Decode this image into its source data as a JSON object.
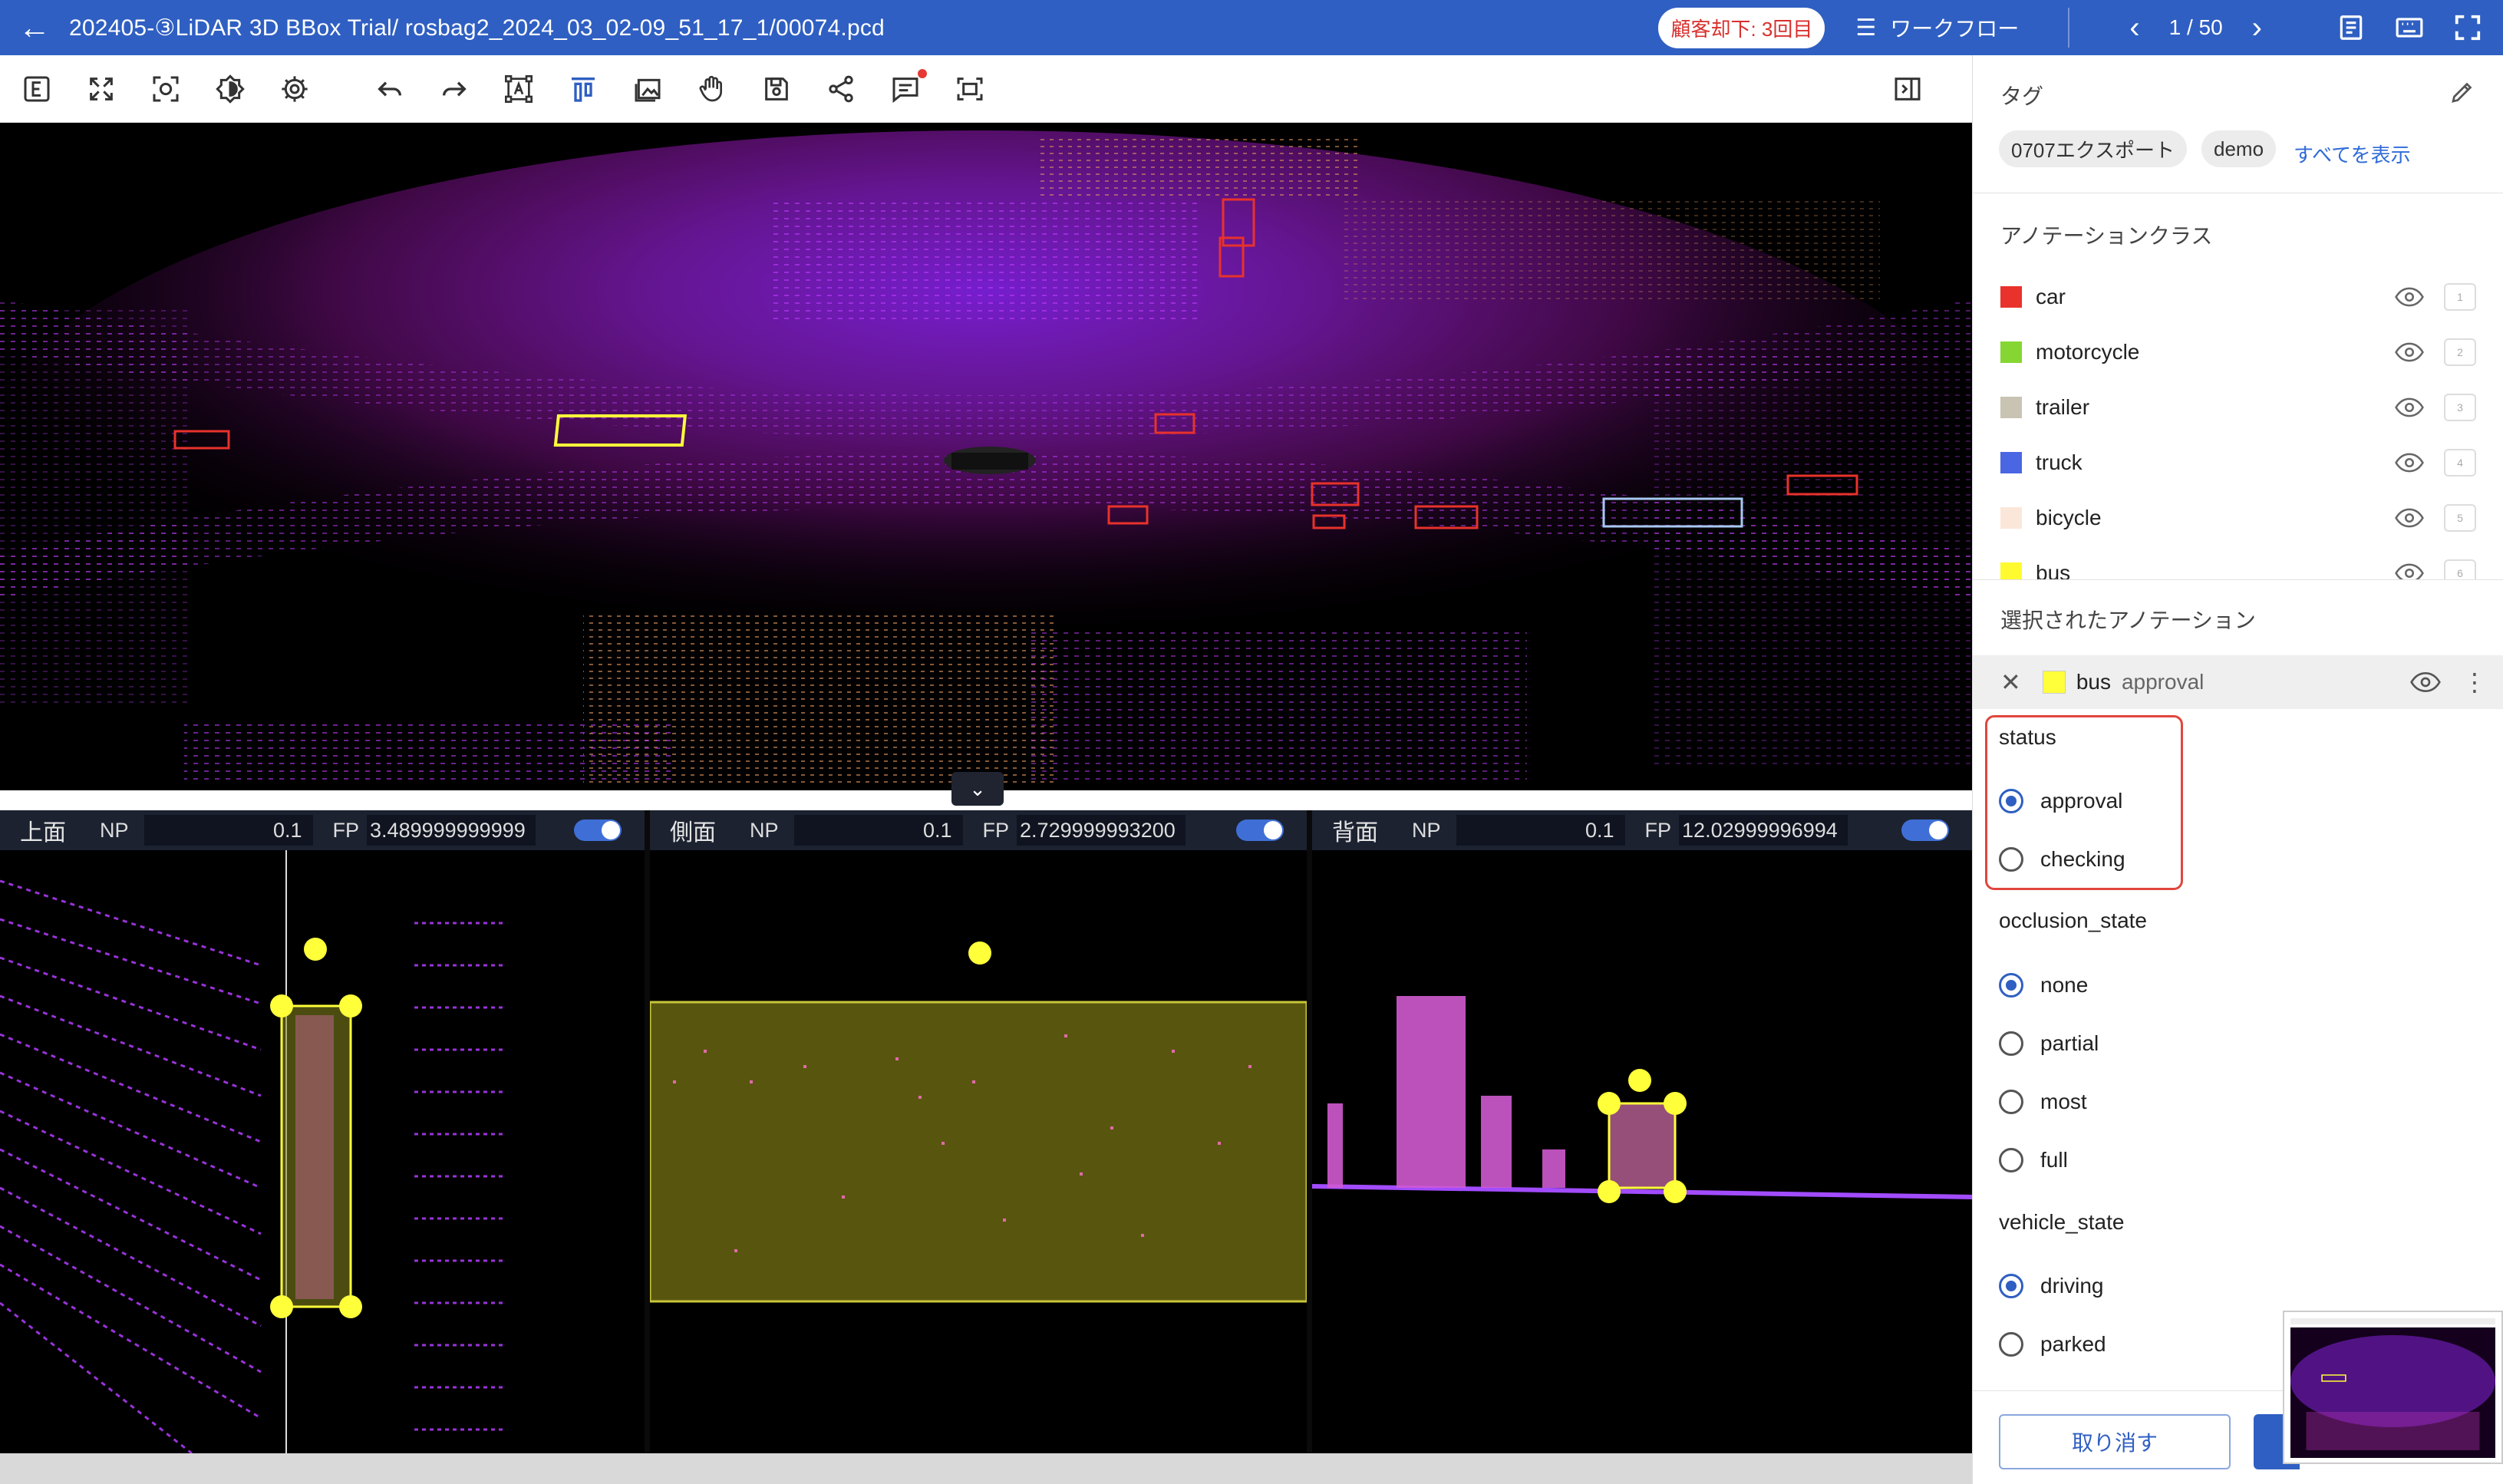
{
  "header": {
    "title": "202405-③LiDAR 3D BBox Trial/ rosbag2_2024_03_02-09_51_17_1/00074.pcd",
    "reject_badge": "顧客却下: 3回目",
    "workflow_label": "ワークフロー",
    "page_indicator": "1 / 50"
  },
  "toolbar": {
    "tools": [
      "e-square-icon",
      "expand-icon",
      "focus-icon",
      "brightness-icon",
      "settings-icon",
      "undo-icon",
      "redo-icon",
      "text-box-icon",
      "align-icon",
      "image-icon",
      "hand-icon",
      "save-icon",
      "share-icon",
      "comment-icon",
      "capture-icon"
    ],
    "active_tool": "align-icon"
  },
  "views": {
    "top": {
      "name": "上面",
      "np_label": "NP",
      "np_value": "0.1",
      "fp_label": "FP",
      "fp_value": "3.489999999999"
    },
    "side": {
      "name": "側面",
      "np_label": "NP",
      "np_value": "0.1",
      "fp_label": "FP",
      "fp_value": "2.729999993200"
    },
    "back": {
      "name": "背面",
      "np_label": "NP",
      "np_value": "0.1",
      "fp_label": "FP",
      "fp_value": "12.02999996994"
    }
  },
  "panel": {
    "tags_title": "タグ",
    "tags": [
      "0707エクスポート",
      "demo"
    ],
    "show_all": "すべてを表示",
    "classes_title": "アノテーションクラス",
    "classes": [
      {
        "name": "car",
        "color": "#e8322b",
        "key": "1"
      },
      {
        "name": "motorcycle",
        "color": "#86d633",
        "key": "2"
      },
      {
        "name": "trailer",
        "color": "#c9c3b3",
        "key": "3"
      },
      {
        "name": "truck",
        "color": "#4a66e3",
        "key": "4"
      },
      {
        "name": "bicycle",
        "color": "#fbe7d9",
        "key": "5"
      },
      {
        "name": "bus",
        "color": "#fffa2f",
        "key": "6"
      }
    ],
    "selected_title": "選択されたアノテーション",
    "selected": {
      "class": "bus",
      "status": "approval"
    },
    "attributes": {
      "status": {
        "label": "status",
        "options": [
          "approval",
          "checking"
        ],
        "selected": "approval"
      },
      "occlusion_state": {
        "label": "occlusion_state",
        "options": [
          "none",
          "partial",
          "most",
          "full"
        ],
        "selected": "none"
      },
      "vehicle_state": {
        "label": "vehicle_state",
        "options": [
          "driving",
          "parked"
        ],
        "selected": "driving"
      }
    },
    "cancel_label": "取り消す"
  }
}
